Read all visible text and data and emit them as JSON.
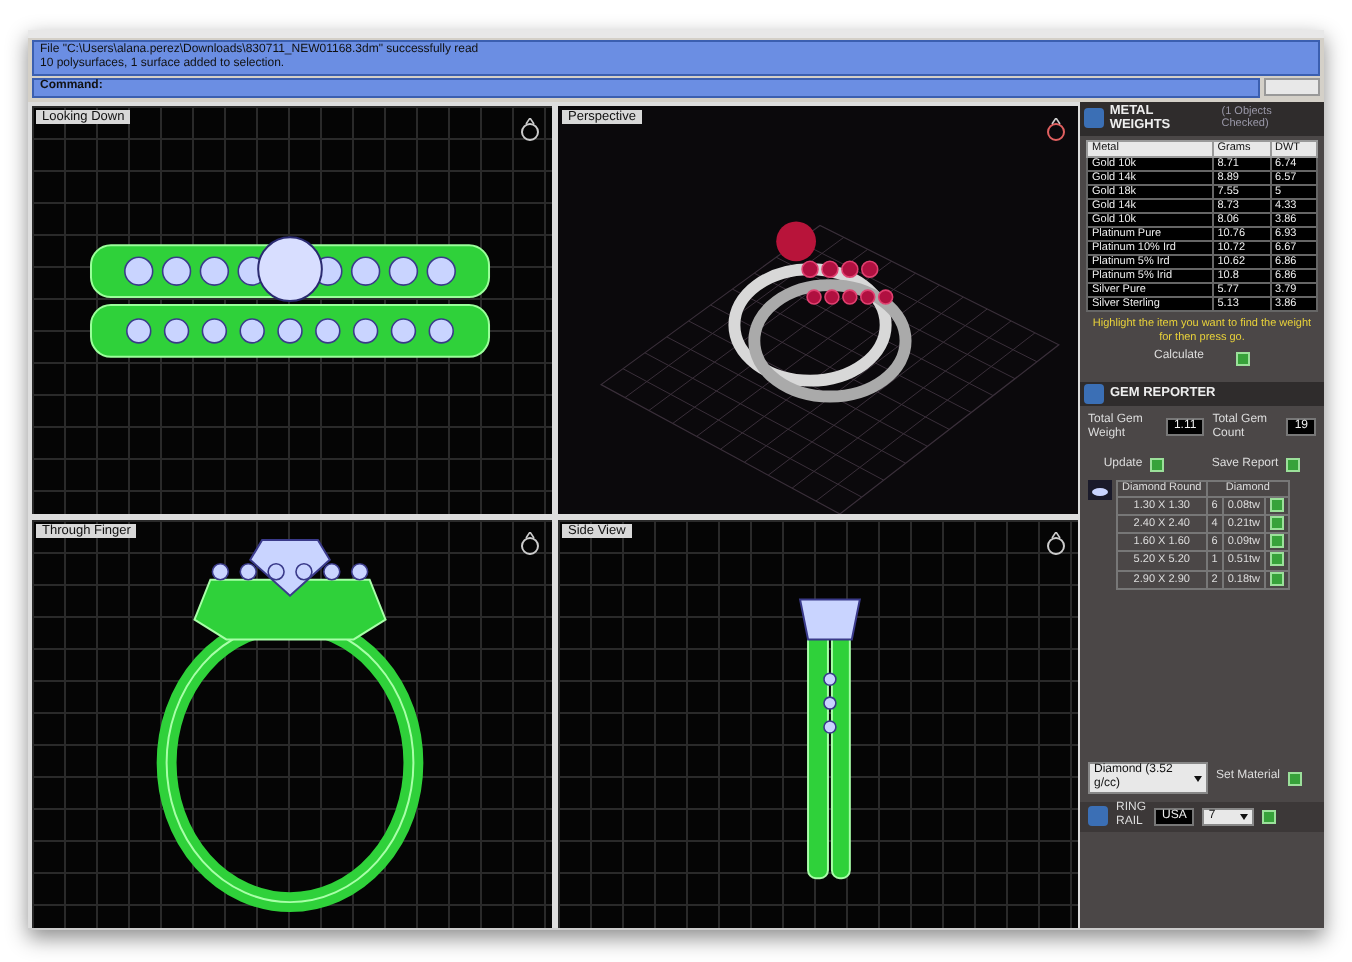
{
  "command_log": {
    "lines": [
      "File \"C:\\Users\\alana.perez\\Downloads\\830711_NEW01168.3dm\" successfully read",
      "10 polysurfaces, 1 surface added to selection."
    ],
    "prompt": "Command:"
  },
  "viewports": [
    {
      "title": "Looking Down",
      "kind": "top"
    },
    {
      "title": "Perspective",
      "kind": "perspective"
    },
    {
      "title": "Through Finger",
      "kind": "front"
    },
    {
      "title": "Side View",
      "kind": "side"
    }
  ],
  "metal_weights": {
    "title": "METAL WEIGHTS",
    "subtitle": "(1 Objects Checked)",
    "columns": [
      "Metal",
      "Grams",
      "DWT"
    ],
    "rows": [
      [
        "Gold 10k",
        "8.71",
        "6.74"
      ],
      [
        "Gold 14k",
        "8.89",
        "6.57"
      ],
      [
        "Gold 18k",
        "7.55",
        "5"
      ],
      [
        "Gold 14k",
        "8.73",
        "4.33"
      ],
      [
        "Gold 10k",
        "8.06",
        "3.86"
      ],
      [
        "Platinum Pure",
        "10.76",
        "6.93"
      ],
      [
        "Platinum 10% Ird",
        "10.72",
        "6.67"
      ],
      [
        "Platinum 5% Ird",
        "10.62",
        "6.86"
      ],
      [
        "Platinum 5% Irid",
        "10.8",
        "6.86"
      ],
      [
        "Silver Pure",
        "5.77",
        "3.79"
      ],
      [
        "Silver Sterling",
        "5.13",
        "3.86"
      ]
    ],
    "hint": "Highlight the item you want to find the weight for then press go.",
    "calculate_label": "Calculate"
  },
  "gem_reporter": {
    "title": "GEM REPORTER",
    "total_weight_label": "Total Gem Weight",
    "total_weight": "1.11",
    "total_count_label": "Total Gem Count",
    "total_count": "19",
    "update_label": "Update",
    "save_label": "Save Report",
    "columns": [
      "Diamond Round",
      "Diamond"
    ],
    "rows": [
      {
        "size": "1.30 X 1.30",
        "count": "6",
        "weight": "0.08tw"
      },
      {
        "size": "2.40 X 2.40",
        "count": "4",
        "weight": "0.21tw"
      },
      {
        "size": "1.60 X 1.60",
        "count": "6",
        "weight": "0.09tw"
      },
      {
        "size": "5.20 X 5.20",
        "count": "1",
        "weight": "0.51tw"
      },
      {
        "size": "2.90 X 2.90",
        "count": "2",
        "weight": "0.18tw"
      }
    ],
    "material": "Diamond (3.52 g/cc)",
    "set_material_label": "Set Material"
  },
  "ring_rail": {
    "label_top": "RING",
    "label_bottom": "RAIL",
    "country": "USA",
    "size": "7"
  }
}
